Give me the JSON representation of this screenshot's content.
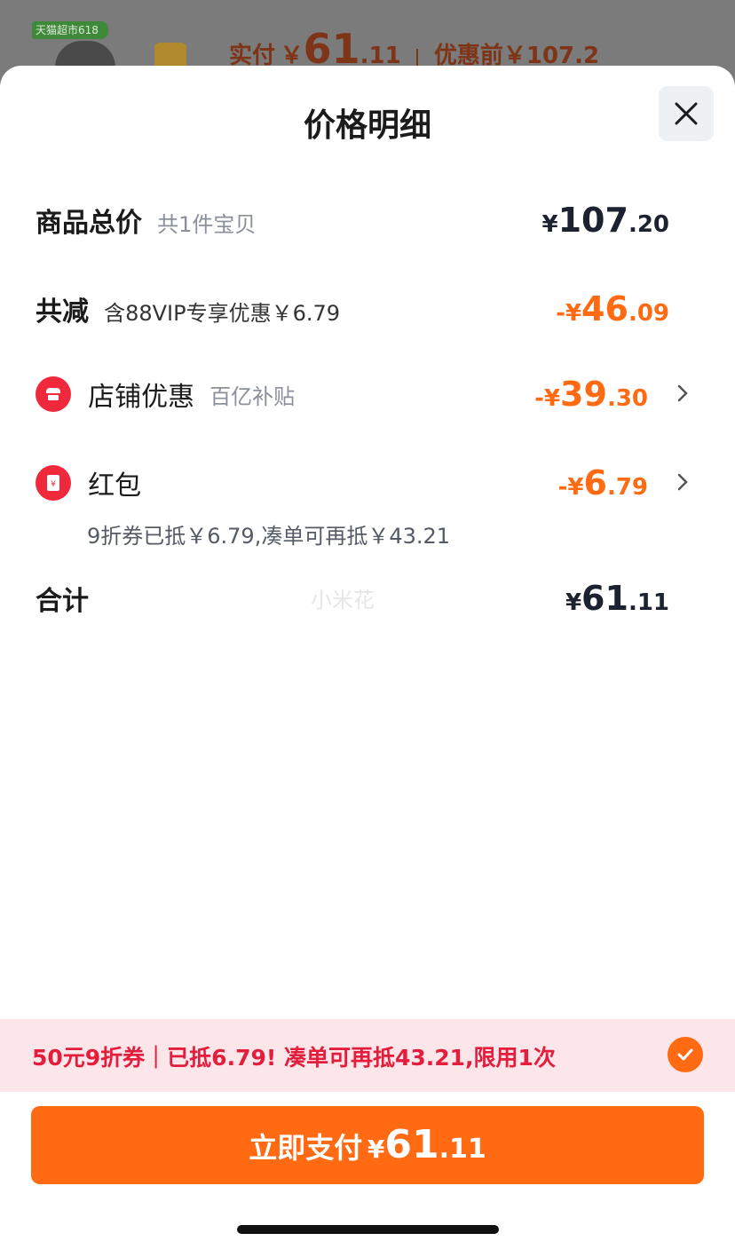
{
  "background": {
    "badge": "天猫超市618",
    "pay_label": "实付",
    "pay_currency": "￥",
    "pay_int": "61",
    "pay_dec": ".11",
    "before_label": "优惠前",
    "before_value": "￥107.2"
  },
  "sheet": {
    "title": "价格明细",
    "close_icon": "close-icon"
  },
  "rows": {
    "total": {
      "label": "商品总价",
      "note": "共1件宝贝",
      "currency": "¥",
      "int": "107",
      "dec": ".20"
    },
    "reduce": {
      "label": "共减",
      "note": "含88VIP专享优惠￥6.79",
      "currency": "-¥",
      "int": "46",
      "dec": ".09"
    },
    "store": {
      "label": "店铺优惠",
      "note": "百亿补贴",
      "currency": "-¥",
      "int": "39",
      "dec": ".30",
      "icon": "store-icon"
    },
    "redpacket": {
      "label": "红包",
      "currency": "-¥",
      "int": "6",
      "dec": ".79",
      "icon": "red-packet-icon",
      "sub": "9折券已抵￥6.79,凑单可再抵￥43.21"
    },
    "sum": {
      "label": "合计",
      "currency": "¥",
      "int": "61",
      "dec": ".11"
    }
  },
  "watermark": "小米花",
  "promo": {
    "text": "50元9折券｜已抵6.79! 凑单可再抵43.21,限用1次",
    "check_icon": "check-icon"
  },
  "pay_button": {
    "label": "立即支付",
    "currency": "¥",
    "int": "61",
    "dec": ".11"
  },
  "colors": {
    "accent": "#ff6a13",
    "red": "#f0283c",
    "promo_bg": "#fde6ea",
    "promo_text": "#e31d3c"
  }
}
